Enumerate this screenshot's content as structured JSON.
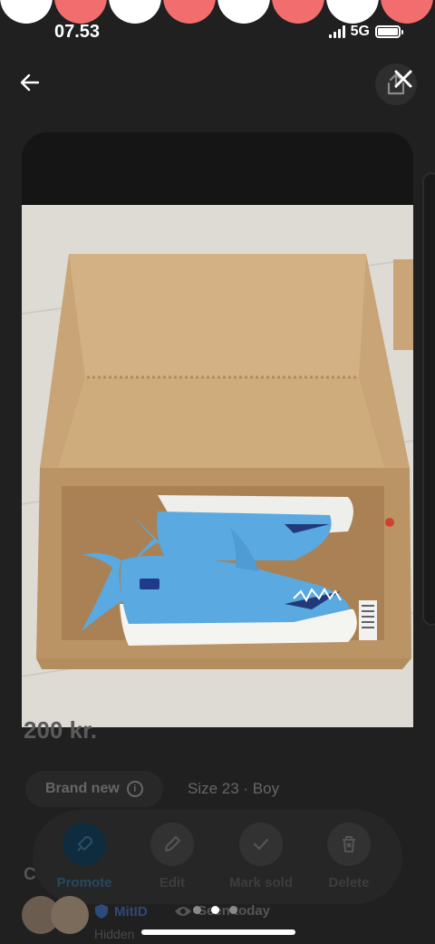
{
  "status": {
    "time": "07.53",
    "network": "5G"
  },
  "recording_dots": [
    "#ffffff",
    "#f26d6d",
    "#ffffff",
    "#f26d6d",
    "#ffffff",
    "#f26d6d",
    "#ffffff",
    "#f26d6d"
  ],
  "icons": {
    "back": "arrow-left-icon",
    "share": "share-icon",
    "close": "close-icon",
    "promote": "rocket-icon",
    "edit": "pencil-icon",
    "mark_sold": "check-icon",
    "delete": "trash-icon"
  },
  "listing": {
    "price": "200 kr.",
    "condition": "Brand new",
    "size": "Size 23 · Boy",
    "photo_count": 3,
    "active_photo": 2
  },
  "actions": {
    "promote": "Promote",
    "edit": "Edit",
    "mark_sold": "Mark sold",
    "delete": "Delete"
  },
  "seller": {
    "section_initial": "C",
    "verified_label": "MitID",
    "seen_label": "Seen today",
    "hidden_label": "Hidden"
  },
  "colors": {
    "background": "#202020",
    "promote_accent": "#0e2c3d",
    "shoe_blue": "#5aa9e0"
  }
}
